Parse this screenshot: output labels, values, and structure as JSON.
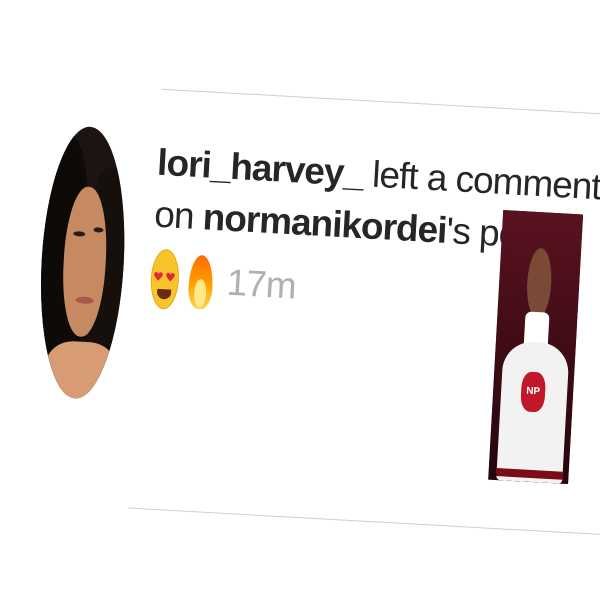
{
  "notification": {
    "username": "lori_harvey_",
    "action_text": " left a comment",
    "on_text": "on ",
    "post_owner": "normanikordei",
    "post_suffix": "'s post:",
    "emojis": [
      "heart-eyes-emoji",
      "fire-emoji"
    ],
    "timestamp": "17m"
  },
  "thumbnail": {
    "logo_text": "NP"
  },
  "colors": {
    "text": "#262626",
    "timestamp": "#b0b0b0",
    "divider": "#cfcfcf"
  }
}
